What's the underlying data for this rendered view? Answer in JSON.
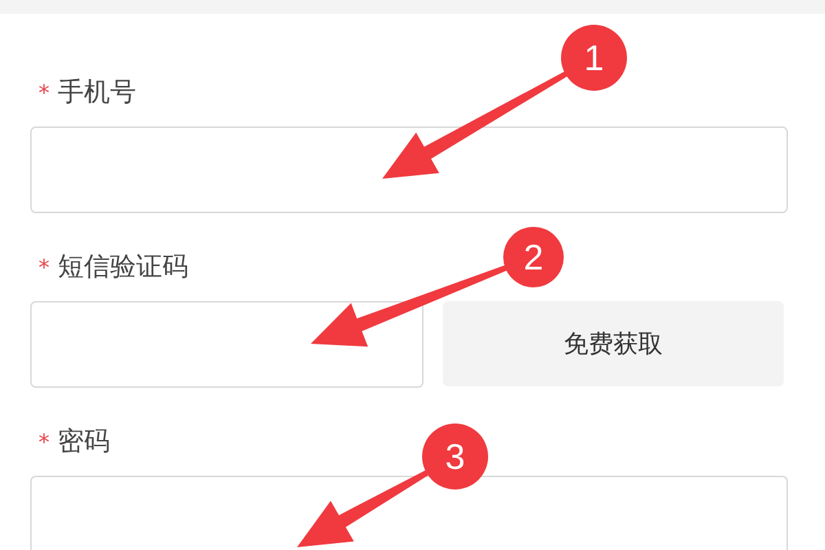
{
  "form": {
    "fields": [
      {
        "kind": "text",
        "label": "手机号",
        "required_mark": "*"
      },
      {
        "kind": "code",
        "label": "短信验证码",
        "required_mark": "*",
        "button": "免费获取"
      },
      {
        "kind": "text",
        "label": "密码",
        "required_mark": "*"
      }
    ]
  },
  "callouts": [
    {
      "number": "1"
    },
    {
      "number": "2"
    },
    {
      "number": "3"
    }
  ]
}
